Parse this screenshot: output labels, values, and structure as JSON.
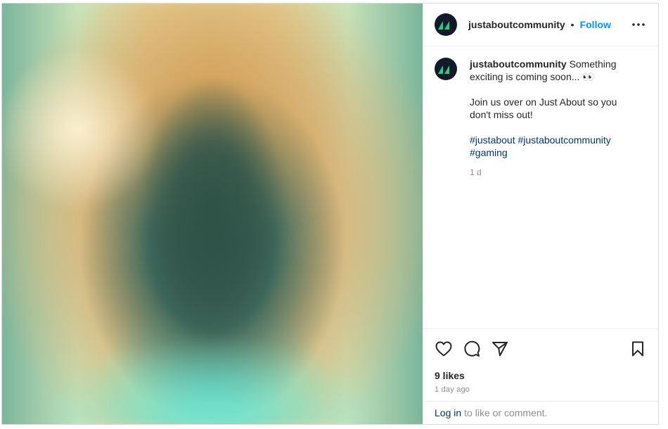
{
  "header": {
    "username": "justaboutcommunity",
    "separator": "•",
    "follow_label": "Follow"
  },
  "caption": {
    "username": "justaboutcommunity",
    "line1": "Something exciting is coming soon... 👀",
    "line2": "Join us over on Just About so you don't miss out!",
    "hashtags": [
      "#justabout",
      "#justaboutcommunity",
      "#gaming"
    ],
    "time": "1 d"
  },
  "actions": {
    "icons": [
      "heart-icon",
      "comment-icon",
      "share-icon",
      "bookmark-icon"
    ]
  },
  "stats": {
    "likes": "9 likes",
    "posted": "1 day ago"
  },
  "footer": {
    "login_link": "Log in",
    "login_text": "to like or comment."
  },
  "colors": {
    "accent": "#0095f6",
    "link": "#00376b",
    "muted": "#8e8e8e",
    "text": "#262626",
    "avatar_bg": "#121a2a",
    "logo_green": "#1fd17c"
  }
}
